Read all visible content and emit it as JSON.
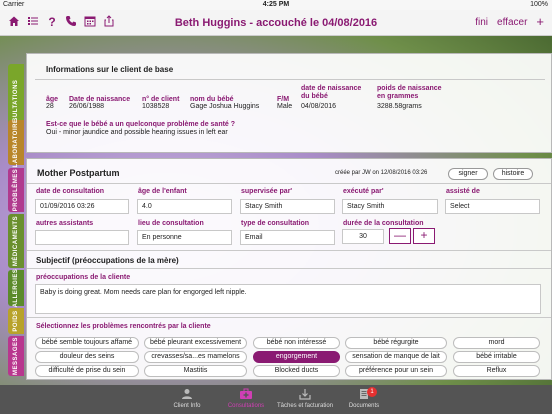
{
  "status": {
    "carrier": "Carrier",
    "time": "4:25 PM",
    "battery": "100%"
  },
  "nav": {
    "title": "Beth Huggins - accouché le 04/08/2016",
    "done": "fini",
    "delete": "effacer",
    "plus": "+"
  },
  "side_tabs": [
    {
      "label": "CONSULTATIONS",
      "color": "#7aa62a"
    },
    {
      "label": "LABORATOIRE",
      "color": "#b8862a"
    },
    {
      "label": "PROBLÈMES",
      "color": "#b03a8e"
    },
    {
      "label": "MÉDICAMENTS",
      "color": "#6a8f2e"
    },
    {
      "label": "ALLERGIES",
      "color": "#5b8a2b"
    },
    {
      "label": "POIDS",
      "color": "#b8a22a"
    },
    {
      "label": "MESSAGES",
      "color": "#b8368e"
    }
  ],
  "client": {
    "heading": "Informations sur le client de base",
    "headers": {
      "age": "âge",
      "dob": "Date de naissance",
      "client_no": "n° de client",
      "baby_name": "nom du bébé",
      "sex": "F/M",
      "baby_dob": "date de naissance du bébé",
      "weight": "poids de naissance en grammes"
    },
    "values": {
      "age": "28",
      "dob": "26/06/1988",
      "client_no": "1038528",
      "baby_name": "Gage Joshua Huggins",
      "sex": "Male",
      "baby_dob": "04/08/2016",
      "weight": "3288.58grams"
    },
    "question": "Est-ce que le bébé a un quelconque problème de santé ?",
    "answer": "Oui - minor jaundice and possible hearing issues in left ear"
  },
  "consult": {
    "title": "Mother Postpartum",
    "created": "créée par JW on 12/08/2016 03:26",
    "sign": "signer",
    "history": "histoire",
    "labels": {
      "date": "date de consultation",
      "child_age": "âge de l'enfant",
      "supervised": "supervisée par'",
      "executed": "exécuté par'",
      "assistant": "assisté de",
      "other": "autres assistants",
      "place": "lieu de consultation",
      "type": "type de consultation",
      "duration": "durée de la consultation"
    },
    "values": {
      "date": "01/09/2016 03:26",
      "child_age": "4.0",
      "supervised": "Stacy Smith",
      "executed": "Stacy Smith",
      "assistant": "Select",
      "other": "",
      "place": "En personne",
      "type": "Email",
      "duration": "30"
    },
    "minus": "—",
    "plus": "+",
    "subjective": "Subjectif (préoccupations de la mère)",
    "concerns_label": "préoccupations de la cliente",
    "concerns": "Baby is doing great. Mom needs care plan for engorged left nipple.",
    "problems_label": "Sélectionnez les problèmes rencontrés par la cliente",
    "problems_row1": [
      "bébé semble toujours affamé",
      "bébé pleurant excessivement",
      "bébé non intéressé",
      "bébé régurgite",
      "mord"
    ],
    "problems_row2": [
      "douleur des seins",
      "crevasses/sa...es mamelons",
      "engorgement",
      "sensation de manque de lait",
      "bébé irritable"
    ],
    "problems_row3": [
      "difficulté de prise du sein",
      "Mastitis",
      "Blocked ducts",
      "préférence pour un sein",
      "Reflux"
    ],
    "selected": "engorgement"
  },
  "tabs": [
    {
      "label": "Client Info"
    },
    {
      "label": "Consultations"
    },
    {
      "label": "Tâches et facturation"
    },
    {
      "label": "Documents",
      "badge": "1"
    }
  ]
}
